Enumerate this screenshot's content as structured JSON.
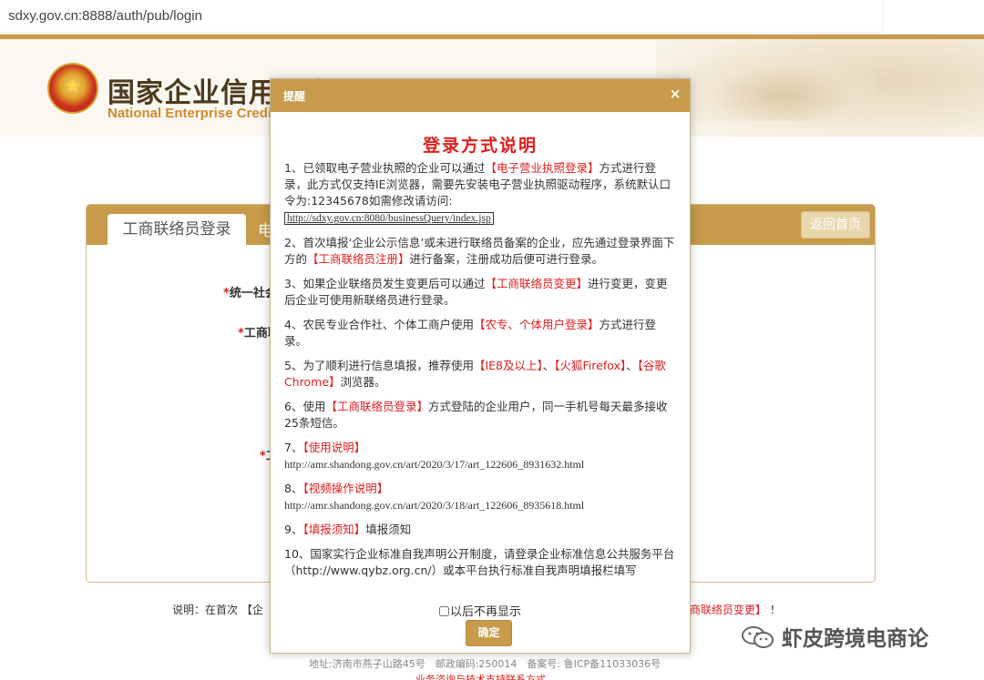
{
  "browser": {
    "url": "sdxy.gov.cn:8888/auth/pub/login"
  },
  "header": {
    "title": "国家企业信用信息公示系统(山东)",
    "subtitle": "National Enterprise Credit Information Publicity System"
  },
  "panel": {
    "tab_active": "工商联络员登录",
    "tab_second": "电",
    "back_home": "返回首页",
    "labels": [
      "统一社会",
      "工商联",
      "工"
    ],
    "required_mark": "*"
  },
  "note": {
    "left": "说明：在首次 【企",
    "right_link": "商联络员变更】",
    "right_tail": "！"
  },
  "footer": {
    "address": "地址:济南市燕子山路45号　邮政编码:250014　备案号: 鲁ICP备11033036号",
    "contact": "业务咨询与技术支持联系方式"
  },
  "watermark": {
    "text": "虾皮跨境电商论"
  },
  "modal": {
    "title": "提醒",
    "close": "×",
    "heading": "登录方式说明",
    "items": {
      "i1_a": "1、已领取电子营业执照的企业可以通过",
      "i1_b": "【电子营业执照登录】",
      "i1_c": "方式进行登录，此方式仅支持IE浏览器，需要先安装电子营业执照驱动程序，系统默认口令为:12345678如需修改请访问:",
      "i1_link": "http://sdxy.gov.cn:8080/businessQuery/index.jsp",
      "i2_a": "2、首次填报‘企业公示信息’或未进行联络员备案的企业，应先通过登录界面下方的",
      "i2_b": "【工商联络员注册】",
      "i2_c": "进行备案，注册成功后便可进行登录。",
      "i3_a": "3、如果企业联络员发生变更后可以通过",
      "i3_b": "【工商联络员变更】",
      "i3_c": "进行变更，变更后企业可使用新联络员进行登录。",
      "i4_a": "4、农民专业合作社、个体工商户使用",
      "i4_b": "【农专、个体用户登录】",
      "i4_c": "方式进行登录。",
      "i5_a": "5、为了顺利进行信息填报，推荐使用",
      "i5_b": "【IE8及以上】",
      "i5_sep1": "、",
      "i5_c": "【火狐Firefox】",
      "i5_sep2": "、",
      "i5_d": "【谷歌Chrome】",
      "i5_e": "浏览器。",
      "i6_a": "6、使用",
      "i6_b": "【工商联络员登录】",
      "i6_c": "方式登陆的企业用户，同一手机号每天最多接收25条短信。",
      "i7_a": "7、",
      "i7_b": "【使用说明】",
      "i7_url": "http://amr.shandong.gov.cn/art/2020/3/17/art_122606_8931632.html",
      "i8_a": "8、",
      "i8_b": "【视频操作说明】",
      "i8_url": "http://amr.shandong.gov.cn/art/2020/3/18/art_122606_8935618.html",
      "i9_a": "9、",
      "i9_b": "【填报须知】",
      "i9_c": "填报须知",
      "i10": "10、国家实行企业标准自我声明公开制度，请登录企业标准信息公共服务平台（http://www.qybz.org.cn/）或本平台执行标准自我声明填报栏填写"
    },
    "dont_show": "以后不再显示",
    "ok": "确定"
  }
}
